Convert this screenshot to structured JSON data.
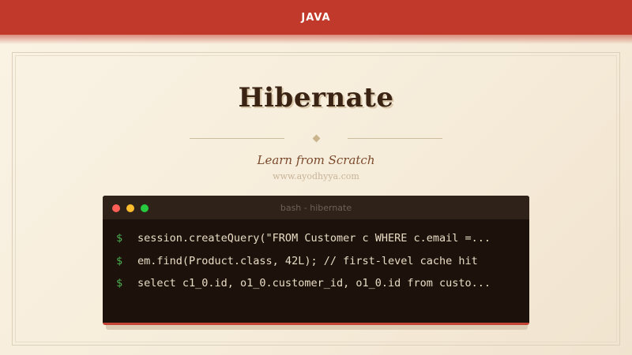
{
  "header": {
    "category": "JAVA"
  },
  "hero": {
    "title": "Hibernate",
    "subtitle": "Learn from Scratch",
    "website": "www.ayodhyya.com"
  },
  "terminal": {
    "title": "bash - hibernate",
    "prompt": "$",
    "lines": [
      "session.createQuery(\"FROM Customer c WHERE c.email =...",
      "em.find(Product.class, 42L); // first-level cache hit",
      "select c1_0.id, o1_0.customer_id, o1_0.id from custo..."
    ]
  },
  "colors": {
    "accent": "#c0392b",
    "title": "#3b2314",
    "terminal_bg": "#1c120b",
    "prompt": "#4caf50"
  }
}
